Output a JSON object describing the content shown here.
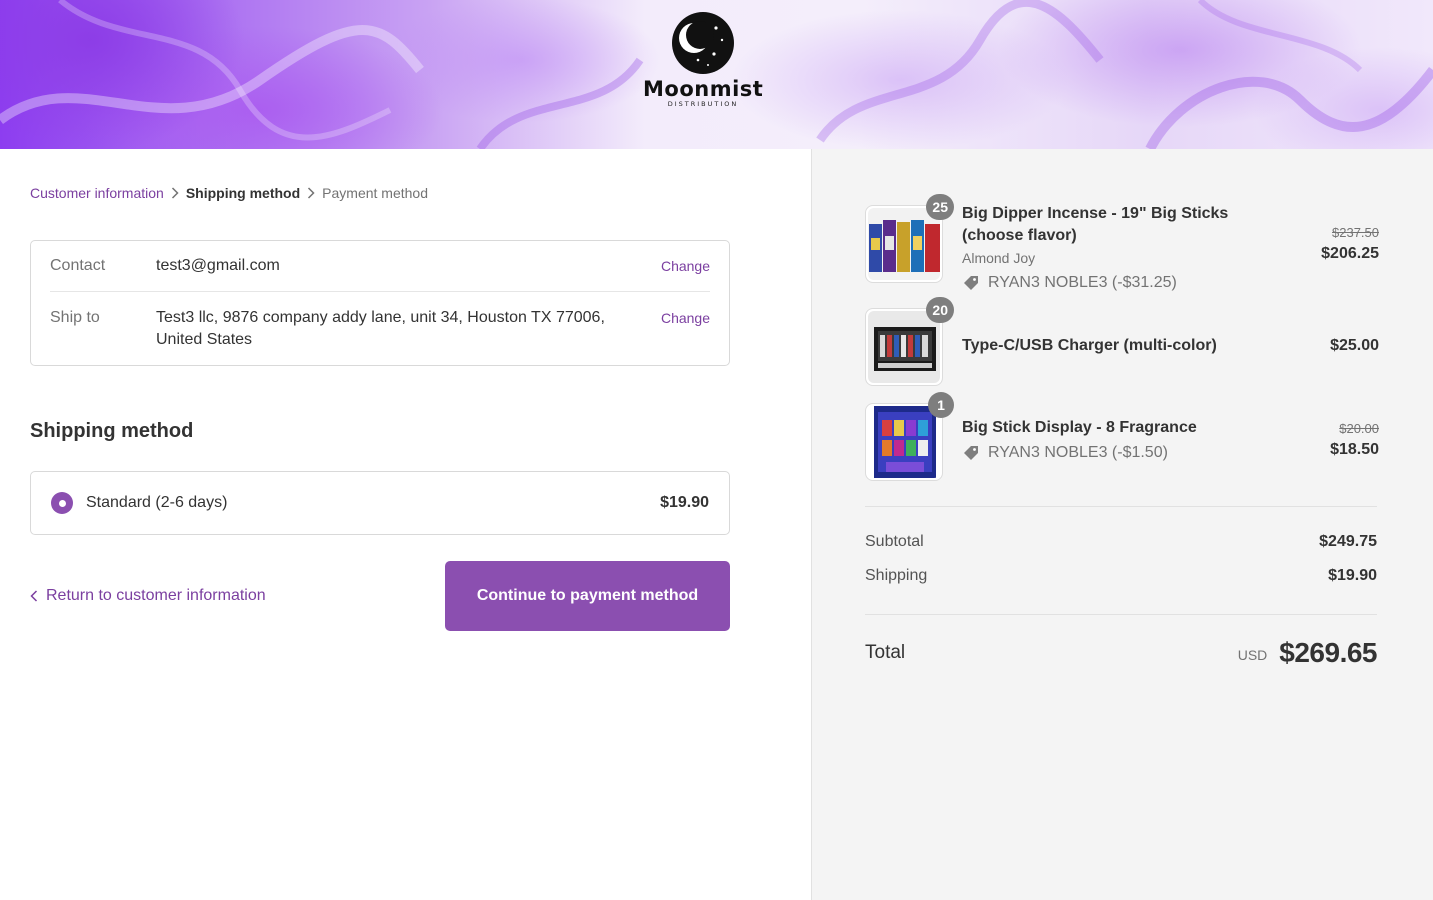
{
  "brand": {
    "name": "Moonmist",
    "tagline": "DISTRIBUTION"
  },
  "breadcrumb": {
    "step1": "Customer information",
    "step2": "Shipping method",
    "step3": "Payment method"
  },
  "review": {
    "contact_label": "Contact",
    "contact_value": "test3@gmail.com",
    "contact_change": "Change",
    "shipto_label": "Ship to",
    "shipto_value": "Test3 llc, 9876 company addy lane, unit 34, Houston TX 77006, United States",
    "shipto_change": "Change"
  },
  "shipping": {
    "title": "Shipping method",
    "rate_label": "Standard (2-6 days)",
    "rate_price": "$19.90",
    "selected": true
  },
  "footer": {
    "return_label": "Return to customer information",
    "continue_label": "Continue to payment method"
  },
  "order": {
    "items": [
      {
        "qty": "25",
        "title": "Big Dipper Incense - 19\" Big Sticks (choose flavor)",
        "variant": "Almond Joy",
        "discount": "RYAN3 NOBLE3 (-$31.25)",
        "original_price": "$237.50",
        "price": "$206.25"
      },
      {
        "qty": "20",
        "title": "Type-C/USB Charger (multi-color)",
        "price": "$25.00"
      },
      {
        "qty": "1",
        "title": "Big Stick Display - 8 Fragrance",
        "discount": "RYAN3 NOBLE3 (-$1.50)",
        "original_price": "$20.00",
        "price": "$18.50"
      }
    ],
    "subtotal_label": "Subtotal",
    "subtotal_value": "$249.75",
    "shipping_label": "Shipping",
    "shipping_value": "$19.90",
    "total_label": "Total",
    "total_currency": "USD",
    "total_value": "$269.65"
  },
  "colors": {
    "accent": "#8b4fb0",
    "link": "#7b3fa0",
    "sidebar_bg": "#f4f4f4"
  }
}
